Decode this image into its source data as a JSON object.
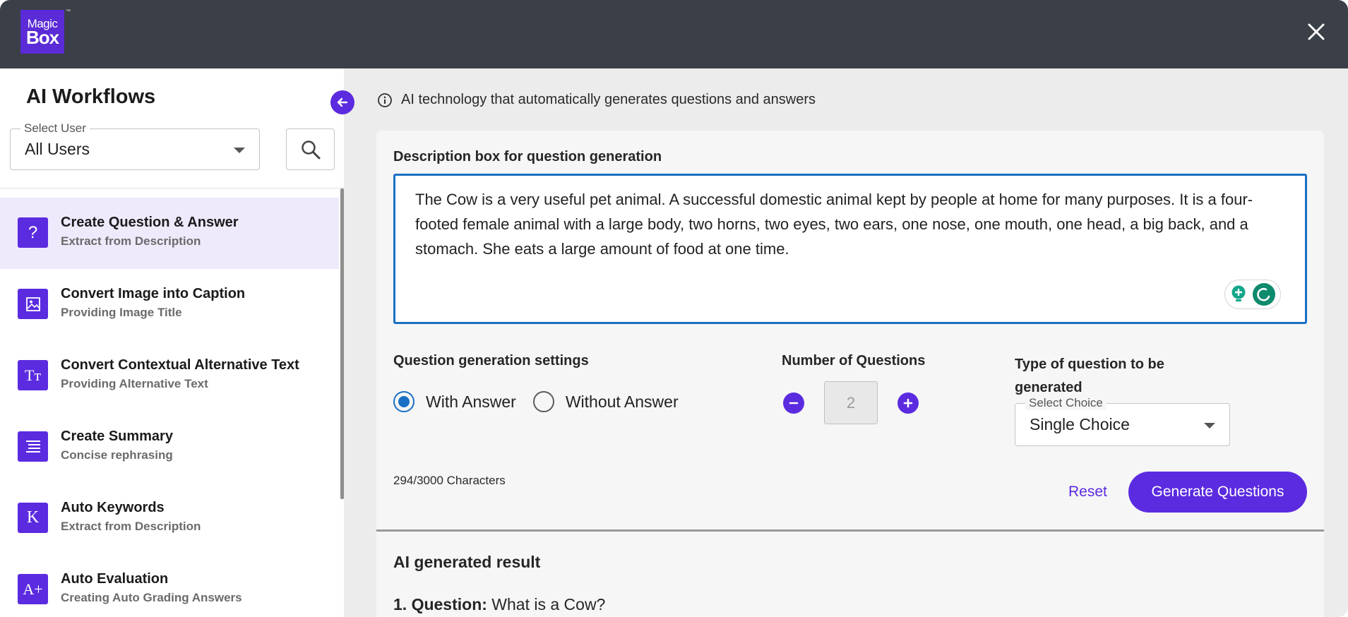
{
  "header": {
    "logo_line1": "Magic",
    "logo_line2": "Box",
    "logo_tm": "™"
  },
  "sidebar": {
    "title": "AI Workflows",
    "select_user": {
      "legend": "Select User",
      "value": "All Users"
    },
    "items": [
      {
        "title": "Create Question & Answer",
        "subtitle": "Extract from Description",
        "icon": "question-mark-icon",
        "glyph": "?",
        "active": true
      },
      {
        "title": "Convert Image into Caption",
        "subtitle": "Providing Image Title",
        "icon": "image-caption-icon",
        "glyph": "",
        "active": false
      },
      {
        "title": "Convert Contextual Alternative Text",
        "subtitle": "Providing Alternative Text",
        "icon": "text-type-icon",
        "glyph": "Tт",
        "active": false
      },
      {
        "title": "Create Summary",
        "subtitle": "Concise rephrasing",
        "icon": "summary-list-icon",
        "glyph": "",
        "active": false
      },
      {
        "title": "Auto Keywords",
        "subtitle": "Extract from Description",
        "icon": "keyword-k-icon",
        "glyph": "K",
        "active": false
      },
      {
        "title": "Auto Evaluation",
        "subtitle": "Creating Auto Grading Answers",
        "icon": "grade-a-plus-icon",
        "glyph": "A+",
        "active": false
      }
    ]
  },
  "main": {
    "info_text": "AI technology that automatically generates questions and answers",
    "description_label": "Description box for question generation",
    "description_text": "The Cow is a very useful pet animal. A successful domestic animal kept by people at home for many purposes. It is a four-footed female animal with a large body, two horns, two eyes, two ears, one nose, one mouth, one head, a big back, and a stomach. She eats a large amount of food at one time.",
    "settings_label": "Question generation settings",
    "radio_with": "With Answer",
    "radio_without": "Without Answer",
    "radio_selected": "With Answer",
    "number_label": "Number of Questions",
    "number_value": "2",
    "type_label": "Type of question to be generated",
    "select_choice": {
      "legend": "Select Choice",
      "value": "Single Choice"
    },
    "char_count": "294/3000 Characters",
    "reset_label": "Reset",
    "generate_label": "Generate Questions",
    "result_title": "AI generated result",
    "result_q_label": "1. Question:",
    "result_q_text": "What is a Cow?"
  },
  "colors": {
    "accent": "#5b2be0",
    "header_bg": "#3b3f47",
    "focus_blue": "#1a6fc4",
    "active_row": "#efe9fc"
  }
}
